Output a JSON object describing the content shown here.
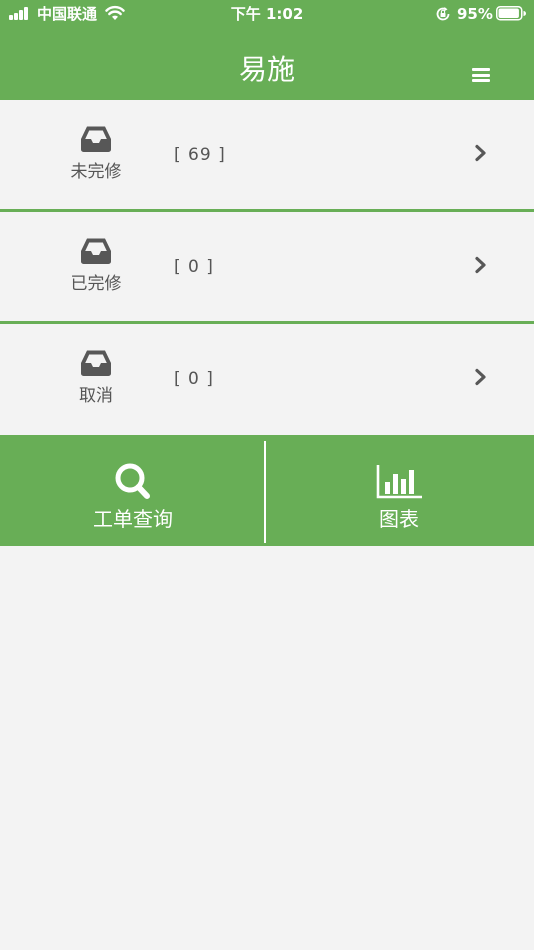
{
  "status_bar": {
    "carrier": "中国联通",
    "time": "下午 1:02",
    "battery_percent": "95%",
    "battery_level": 0.95
  },
  "header": {
    "title": "易施",
    "menu_icon": "hamburger-menu-icon"
  },
  "rows": [
    {
      "label": "未完修",
      "count": "[ 69 ]",
      "icon": "inbox-icon"
    },
    {
      "label": "已完修",
      "count": "[ 0 ]",
      "icon": "inbox-icon"
    },
    {
      "label": "取消",
      "count": "[ 0 ]",
      "icon": "inbox-icon"
    }
  ],
  "actions": [
    {
      "label": "工单查询",
      "icon": "search-icon"
    },
    {
      "label": "图表",
      "icon": "bar-chart-icon"
    }
  ],
  "colors": {
    "brand_green": "#68ae56",
    "background": "#f3f3f3",
    "text": "#555555",
    "icon": "#575757"
  }
}
